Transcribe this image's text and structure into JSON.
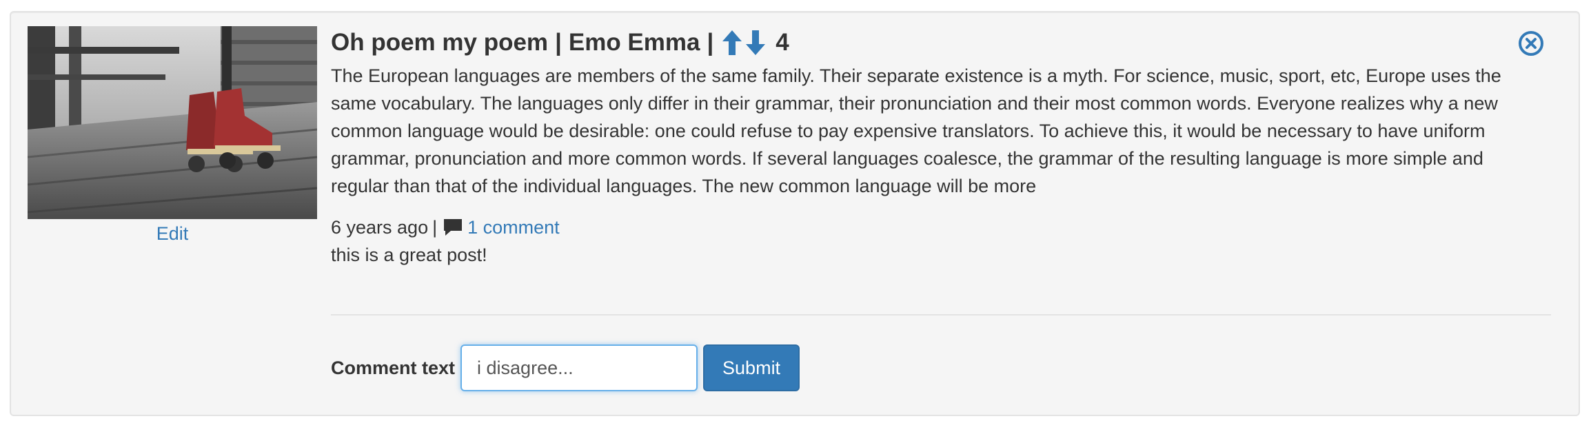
{
  "post": {
    "title": "Oh poem my poem",
    "separator": "|",
    "author": "Emo Emma",
    "score": "4",
    "body": "The European languages are members of the same family. Their separate existence is a myth. For science, music, sport, etc, Europe uses the same vocabulary. The languages only differ in their grammar, their pronunciation and their most common words. Everyone realizes why a new common language would be desirable: one could refuse to pay expensive translators. To achieve this, it would be necessary to have uniform grammar, pronunciation and more common words. If several languages coalesce, the grammar of the resulting language is more simple and regular than that of the individual languages. The new common language will be more",
    "edit_label": "Edit",
    "age": "6 years ago",
    "comments_link": "1 comment",
    "thumbnail_subject": "red roller skates on wooden deck"
  },
  "comments": [
    {
      "text": "this is a great post!"
    }
  ],
  "form": {
    "label": "Comment text",
    "value": "i disagree...",
    "submit_label": "Submit"
  },
  "icons": {
    "upvote": "arrow-up-icon",
    "downvote": "arrow-down-icon",
    "close": "close-circle-icon",
    "comment": "comment-icon"
  },
  "colors": {
    "link": "#337ab7",
    "card_bg": "#f5f5f5",
    "button": "#337ab7"
  }
}
